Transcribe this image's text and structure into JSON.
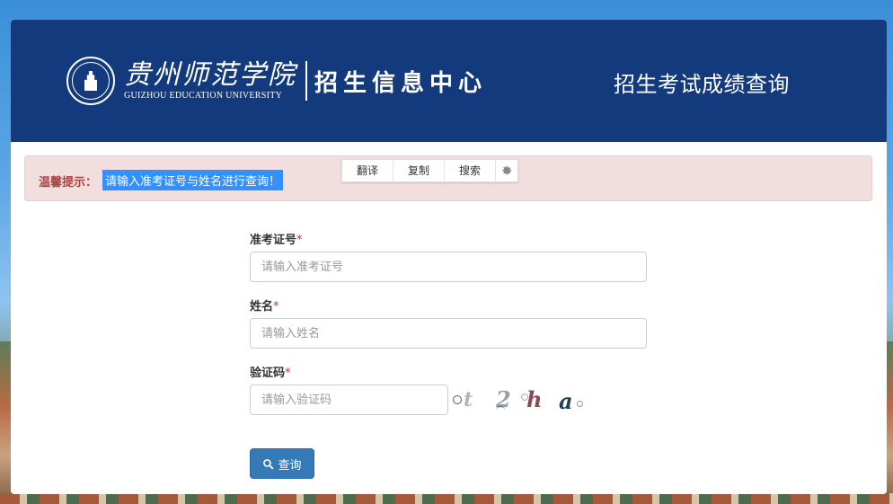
{
  "header": {
    "school_cn": "贵州师范学院",
    "school_en": "GUIZHOU EDUCATION UNIVERSITY",
    "center_name": "招生信息中心",
    "title": "招生考试成绩查询"
  },
  "alert": {
    "label": "温馨提示：",
    "message": "请输入准考证号与姓名进行查询！"
  },
  "toolbar": {
    "translate": "翻译",
    "copy": "复制",
    "search": "搜索"
  },
  "form": {
    "exam_no": {
      "label": "准考证号",
      "required": "*",
      "placeholder": "请输入准考证号"
    },
    "name": {
      "label": "姓名",
      "required": "*",
      "placeholder": "请输入姓名"
    },
    "captcha": {
      "label": "验证码",
      "required": "*",
      "placeholder": "请输入验证码"
    },
    "captcha_chars": [
      "t",
      "2",
      "h",
      "a"
    ],
    "submit_label": "查询"
  },
  "colors": {
    "header_bg": "#133a7c",
    "alert_bg": "#f2dede",
    "alert_text": "#a94442",
    "primary_button": "#337ab7",
    "highlight": "#3390ff"
  }
}
